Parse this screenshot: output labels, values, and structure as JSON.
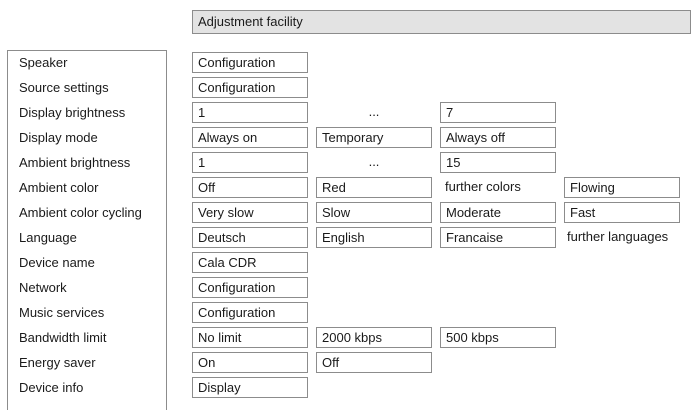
{
  "header": {
    "title": "Adjustment facility"
  },
  "rows": [
    {
      "label": "Speaker",
      "cells": [
        "Configuration"
      ]
    },
    {
      "label": "Source settings",
      "cells": [
        "Configuration"
      ]
    },
    {
      "label": "Display brightness",
      "cells": [
        "1",
        "...",
        "7"
      ]
    },
    {
      "label": "Display mode",
      "cells": [
        "Always on",
        "Temporary",
        "Always off"
      ]
    },
    {
      "label": "Ambient brightness",
      "cells": [
        "1",
        "...",
        "15"
      ]
    },
    {
      "label": "Ambient color",
      "cells": [
        "Off",
        "Red",
        "further colors",
        "Flowing"
      ]
    },
    {
      "label": "Ambient color cycling",
      "cells": [
        "Very slow",
        "Slow",
        "Moderate",
        "Fast"
      ]
    },
    {
      "label": "Language",
      "cells": [
        "Deutsch",
        "English",
        "Francaise",
        "further languages"
      ]
    },
    {
      "label": "Device name",
      "cells": [
        "Cala CDR"
      ]
    },
    {
      "label": "Network",
      "cells": [
        "Configuration"
      ]
    },
    {
      "label": "Music services",
      "cells": [
        "Configuration"
      ]
    },
    {
      "label": "Bandwidth limit",
      "cells": [
        "No limit",
        "2000 kbps",
        "500 kbps"
      ]
    },
    {
      "label": "Energy saver",
      "cells": [
        "On",
        "Off"
      ]
    },
    {
      "label": "Device info",
      "cells": [
        "Display"
      ]
    }
  ]
}
